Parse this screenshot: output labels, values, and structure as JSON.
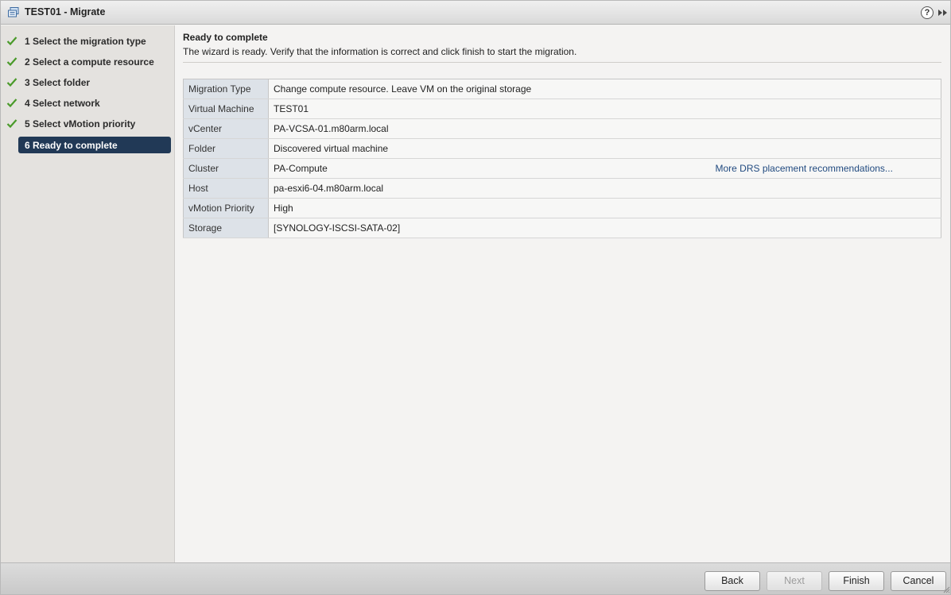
{
  "window": {
    "title": "TEST01 - Migrate"
  },
  "help": {
    "label": "?"
  },
  "sidebar": {
    "steps": [
      {
        "label": "1  Select the migration type",
        "done": true
      },
      {
        "label": "2  Select a compute resource",
        "done": true
      },
      {
        "label": "3  Select folder",
        "done": true
      },
      {
        "label": "4  Select network",
        "done": true
      },
      {
        "label": "5  Select vMotion priority",
        "done": true
      },
      {
        "label": "6  Ready to complete",
        "active": true
      }
    ]
  },
  "main": {
    "heading": "Ready to complete",
    "subheading": "The wizard is ready. Verify that the information is correct and click finish to start the migration.",
    "rows": [
      {
        "key": "Migration Type",
        "value": "Change compute resource. Leave VM on the original storage"
      },
      {
        "key": "Virtual Machine",
        "value": "TEST01"
      },
      {
        "key": "vCenter",
        "value": "PA-VCSA-01.m80arm.local"
      },
      {
        "key": "Folder",
        "value": "Discovered virtual machine"
      },
      {
        "key": "Cluster",
        "value": "PA-Compute",
        "link": "More DRS placement recommendations..."
      },
      {
        "key": "Host",
        "value": "pa-esxi6-04.m80arm.local"
      },
      {
        "key": "vMotion Priority",
        "value": "High"
      },
      {
        "key": "Storage",
        "value": "[SYNOLOGY-ISCSI-SATA-02]"
      }
    ]
  },
  "footer": {
    "back": "Back",
    "next": "Next",
    "finish": "Finish",
    "cancel": "Cancel"
  },
  "colors": {
    "active_step": "#213956",
    "check": "#4a9a2a",
    "link": "#224b80",
    "key_cell": "#dde2e8"
  },
  "icons": {
    "app": "vm-migrate-icon",
    "check": "check-icon",
    "expand": "double-chevron-right-icon"
  }
}
